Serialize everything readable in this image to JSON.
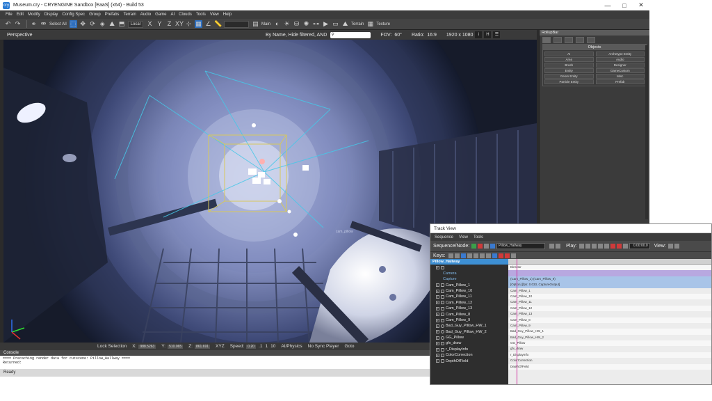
{
  "window": {
    "title": "Museum.cry - CRYENGINE Sandbox [EaaS] (x64) - Build 53",
    "app_icon": "cryengine-icon",
    "controls": [
      "—",
      "□",
      "✕"
    ]
  },
  "menu": [
    "File",
    "Edit",
    "Modify",
    "Display",
    "Config Spec",
    "Group",
    "Prefabs",
    "Terrain",
    "Audio",
    "Game",
    "AI",
    "Clouds",
    "Tools",
    "View",
    "Help"
  ],
  "toolbar": {
    "select_all": "Select All",
    "coord_system": "Local",
    "axis_labels": [
      "X",
      "Y",
      "Z",
      "XY"
    ],
    "main_label": "Main",
    "terrain_label": "Terrain",
    "texture_label": "Texture"
  },
  "viewport": {
    "mode": "Perspective",
    "filter": "By Name, Hide filtered, AND",
    "fov_label": "FOV:",
    "fov_value": "60°",
    "ratio_label": "Ratio:",
    "ratio_value": "16:9",
    "resolution": "1920 x 1080",
    "buttons": [
      "i",
      "H",
      "☰"
    ],
    "entity_label": "cam_pillow"
  },
  "vp_status": {
    "lock_selection": "Lock Selection",
    "x_label": "X:",
    "x_value": "988.5263",
    "y_label": "Y:",
    "y_value": "510.065",
    "z_label": "Z:",
    "z_value": "861.691",
    "xyz": "XYZ",
    "speed_label": "Speed:",
    "speed_value": "0.20",
    "speed_steps": [
      ".1",
      "1",
      "10"
    ],
    "ai_physics": "AI/Physics",
    "no_sync": "No Sync Player",
    "goto": "Goto"
  },
  "console": {
    "header": "Console",
    "lines": [
      "==== Precaching render data for cutscene: Pillow_Hallway ====",
      "Returned:"
    ]
  },
  "status": "Ready",
  "rollup": {
    "header": "RollupBar",
    "objects_header": "Objects",
    "buttons": [
      "AI",
      "Archetype Entity",
      "Area",
      "Audio",
      "Brush",
      "Designer",
      "Entity",
      "GameCustom",
      "Geom Entity",
      "Misc",
      "Particle Entity",
      "Prefab"
    ]
  },
  "trackview": {
    "title": "Track View",
    "menu": [
      "Sequence",
      "View",
      "Tools"
    ],
    "sequence_label": "Sequence/Node:",
    "sequence_value": "Pillow_Hallway",
    "play_label": "Play:",
    "time_value": "0.00:00.0",
    "view_label": "View:",
    "keys_label": "Keys:",
    "tree": [
      {
        "name": "Pillow_Hallway",
        "type": "sel"
      },
      {
        "name": "",
        "type": "group"
      },
      {
        "name": "Camera",
        "type": "sub"
      },
      {
        "name": "Capture",
        "type": "sub"
      },
      {
        "name": "Cam_Pillow_1",
        "type": "node"
      },
      {
        "name": "Cam_Pillow_10",
        "type": "node"
      },
      {
        "name": "Cam_Pillow_11",
        "type": "node"
      },
      {
        "name": "Cam_Pillow_12",
        "type": "node"
      },
      {
        "name": "Cam_Pillow_13",
        "type": "node"
      },
      {
        "name": "Cam_Pillow_8",
        "type": "node"
      },
      {
        "name": "Cam_Pillow_9",
        "type": "node"
      },
      {
        "name": "Bad_Guy_Pillow_HW_1",
        "type": "ent"
      },
      {
        "name": "Bad_Guy_Pillow_HW_2",
        "type": "ent"
      },
      {
        "name": "GG_Pillow",
        "type": "ent"
      },
      {
        "name": "gfx_draw",
        "type": "plain"
      },
      {
        "name": "r_DisplayInfo",
        "type": "plain"
      },
      {
        "name": "ColorCorrection",
        "type": "node"
      },
      {
        "name": "DepthOfField",
        "type": "node"
      }
    ],
    "timeline": [
      {
        "text": "Director",
        "style": "alt"
      },
      {
        "text": "",
        "style": "purple"
      },
      {
        "text": "(Cam_Pillow_1)                                          (Cam_Pillow_9)",
        "style": "blue"
      },
      {
        "text": "[Option] [fps: 0.033, CaptureOutput]",
        "style": "blue"
      },
      {
        "text": "Cam_Pillow_1",
        "style": ""
      },
      {
        "text": "Cam_Pillow_10",
        "style": "alt"
      },
      {
        "text": "Cam_Pillow_11",
        "style": ""
      },
      {
        "text": "Cam_Pillow_12",
        "style": "alt"
      },
      {
        "text": "Cam_Pillow_13",
        "style": ""
      },
      {
        "text": "Cam_Pillow_8",
        "style": "alt"
      },
      {
        "text": "Cam_Pillow_9",
        "style": ""
      },
      {
        "text": "Bad_Guy_Pillow_HW_1",
        "style": "alt"
      },
      {
        "text": "Bad_Guy_Pillow_HW_2",
        "style": ""
      },
      {
        "text": "GG_Pillow",
        "style": "alt"
      },
      {
        "text": "gfx_draw",
        "style": ""
      },
      {
        "text": "r_DisplayInfo",
        "style": "alt"
      },
      {
        "text": "ColorCorrection",
        "style": ""
      },
      {
        "text": "DepthOfField",
        "style": "alt"
      }
    ]
  }
}
